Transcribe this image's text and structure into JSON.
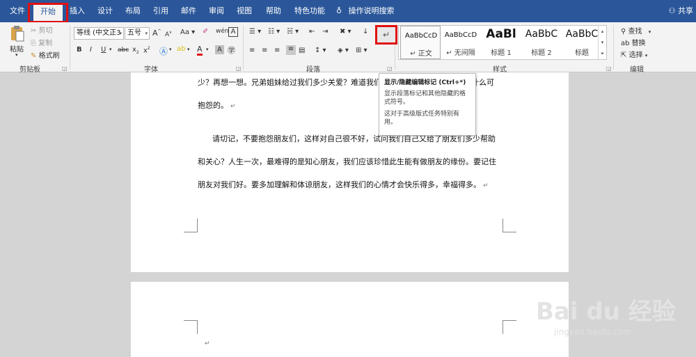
{
  "tabs": [
    {
      "label": "文件"
    },
    {
      "label": "开始"
    },
    {
      "label": "插入"
    },
    {
      "label": "设计"
    },
    {
      "label": "布局"
    },
    {
      "label": "引用"
    },
    {
      "label": "邮件"
    },
    {
      "label": "审阅"
    },
    {
      "label": "视图"
    },
    {
      "label": "帮助"
    },
    {
      "label": "特色功能"
    }
  ],
  "search_tab": "操作说明搜索",
  "share": "共享",
  "clipboard": {
    "paste": "粘贴",
    "cut": "剪切",
    "copy": "复制",
    "format_painter": "格式刷",
    "group": "剪贴板"
  },
  "font": {
    "name": "等线 (中文正3",
    "size": "五号",
    "grow": "A",
    "shrink": "A",
    "case": "Aa",
    "bold": "B",
    "italic": "I",
    "underline": "U",
    "strike": "abc",
    "subscript": "x",
    "superscript": "x",
    "group": "字体"
  },
  "paragraph": {
    "group": "段落",
    "show_marks": "↵"
  },
  "styles": {
    "group": "样式",
    "items": [
      {
        "sample": "AaBbCcD",
        "name": "↵ 正文"
      },
      {
        "sample": "AaBbCcD",
        "name": "↵ 无间隔"
      },
      {
        "sample": "AaBl",
        "name": "标题 1"
      },
      {
        "sample": "AaBbC",
        "name": "标题 2"
      },
      {
        "sample": "AaBbC",
        "name": "标题"
      }
    ]
  },
  "editing": {
    "find": "查找",
    "replace": "替换",
    "select": "选择",
    "group": "编辑"
  },
  "tooltip": {
    "title": "显示/隐藏编辑标记 (Ctrl+*)",
    "desc1": "显示段落标记和其他隐藏的格式符号。",
    "desc2": "这对于高级版式任务特别有用。"
  },
  "document": {
    "lines": [
      "少？再想一想。兄弟姐妹给过我们多少关爱？难道我们",
      "抱怨的。",
      "请切记，不要抱怨朋友们，这样对自己很不好，试问我们自己又给了朋友们多少帮助",
      "和关心？人生一次，最难得的是知心朋友，我们应该珍惜此生能有做朋友的缘份。要记住",
      "朋友对我们好。要多加理解和体谅朋友，这样我们的心情才会快乐得多，幸福得多。"
    ],
    "line1_tail": "什么可",
    "page2_mark": "↵"
  },
  "watermark": {
    "main": "Bai du 经验",
    "sub": "jingyan.baidu.com"
  },
  "colors": {
    "ribbon_blue": "#2b579a",
    "highlight_red": "#e01010"
  }
}
